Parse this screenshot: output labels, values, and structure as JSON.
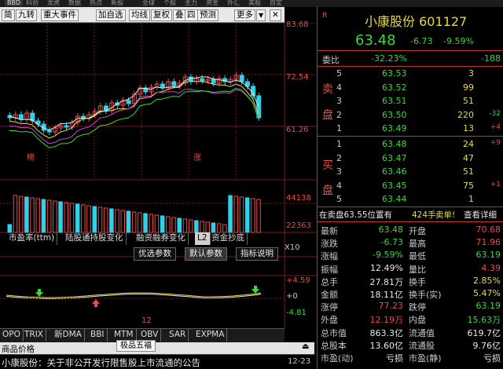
{
  "topstrip": [
    "BBD",
    "科创",
    "龙虎",
    "数据",
    "热点",
    "新股",
    "全球",
    "个股",
    "主力",
    "资金",
    "外汇",
    "美股",
    "自定"
  ],
  "toolbar": {
    "items": [
      "简",
      "九转",
      "重大事件",
      "加自选",
      "均线",
      "复权",
      "叠",
      "四",
      "预测",
      "更多"
    ],
    "arrow_down": "▼",
    "close": "✕"
  },
  "price_axis": {
    "top": "83.68",
    "mid": "72.54",
    "low": "61.26"
  },
  "volume_axis": {
    "top": "44138",
    "mid": "22363",
    "unit": "X10"
  },
  "indicator_axis": {
    "top": "+4.59",
    "zero": "+0",
    "low": "-4.81"
  },
  "markers": {
    "bang": "榜",
    "zhang": "涨",
    "date": "12"
  },
  "indicator_tabs": [
    "市盈率(ttm)",
    "陆股通持股变化",
    "融资融券变化",
    "L2",
    "资金抄底"
  ],
  "indicator_tabs_active": "L2",
  "param_tabs": [
    "优选参数",
    "默认参数",
    "指标说明"
  ],
  "bottom_tabs": [
    "OPO",
    "TRIX",
    "新DMA",
    "BBI",
    "MTM",
    "OBV",
    "SAR",
    "EXPMA"
  ],
  "bottom_popup": "极品五福",
  "news": {
    "header": "商品价格",
    "text": "小康股份：关于非公开发行限售股上市流通的公告",
    "date": "12-23"
  },
  "stock": {
    "badge": "R",
    "name": "小康股份",
    "code": "601127",
    "price": "63.48",
    "change": "-6.73",
    "change_pct": "-9.59%"
  },
  "webi": {
    "label": "委比",
    "value": "-32.23%",
    "diff": "-188"
  },
  "sell": {
    "label": "卖盘",
    "rows": [
      {
        "n": "5",
        "price": "63.53",
        "vol": "3",
        "chg": ""
      },
      {
        "n": "4",
        "price": "63.52",
        "vol": "99",
        "chg": ""
      },
      {
        "n": "3",
        "price": "63.51",
        "vol": "51",
        "chg": ""
      },
      {
        "n": "2",
        "price": "63.50",
        "vol": "220",
        "chg": "-32"
      },
      {
        "n": "1",
        "price": "63.49",
        "vol": "13",
        "chg": "+4"
      }
    ]
  },
  "buy": {
    "label": "买盘",
    "rows": [
      {
        "n": "1",
        "price": "63.48",
        "vol": "24",
        "chg": "+9"
      },
      {
        "n": "2",
        "price": "63.47",
        "vol": "47",
        "chg": ""
      },
      {
        "n": "3",
        "price": "63.46",
        "vol": "51",
        "chg": ""
      },
      {
        "n": "4",
        "price": "63.45",
        "vol": "75",
        "chg": "+1"
      },
      {
        "n": "5",
        "price": "63.44",
        "vol": "1",
        "chg": ""
      }
    ]
  },
  "sell_note": {
    "text": "在卖盘63.55位置有",
    "qty": "424手",
    "action": "卖单!",
    "link": "查看详细"
  },
  "stats": [
    {
      "l1": "最新",
      "v1": "63.48",
      "c1": "gr",
      "l2": "开盘",
      "v2": "70.68",
      "c2": "r"
    },
    {
      "l1": "涨跌",
      "v1": "-6.73",
      "c1": "gr",
      "l2": "最高",
      "v2": "71.96",
      "c2": "r"
    },
    {
      "l1": "涨幅",
      "v1": "-9.59%",
      "c1": "gr",
      "l2": "最低",
      "v2": "63.19",
      "c2": "gr"
    },
    {
      "l1": "振幅",
      "v1": "12.49%",
      "c1": "w",
      "l2": "量比",
      "v2": "4.39",
      "c2": "r"
    },
    {
      "l1": "总手",
      "v1": "27.81万",
      "c1": "w",
      "l2": "换手",
      "v2": "2.85%",
      "c2": "y"
    },
    {
      "l1": "金额",
      "v1": "18.11亿",
      "c1": "w",
      "l2": "换手(实)",
      "v2": "5.47%",
      "c2": "y"
    },
    {
      "l1": "涨停",
      "v1": "77.23",
      "c1": "r",
      "l2": "跌停",
      "v2": "63.19",
      "c2": "gr"
    },
    {
      "l1": "外盘",
      "v1": "12.19万",
      "c1": "r",
      "l2": "内盘",
      "v2": "15.63万",
      "c2": "gr"
    },
    {
      "l1": "总市值",
      "v1": "863.3亿",
      "c1": "w",
      "l2": "流通值",
      "v2": "619.7亿",
      "c2": "w"
    },
    {
      "l1": "总股本",
      "v1": "13.60亿",
      "c1": "w",
      "l2": "流通股",
      "v2": "9.76亿",
      "c2": "w"
    },
    {
      "l1": "市盈(动)",
      "v1": "亏损",
      "c1": "w",
      "l2": "市盈(静)",
      "v2": "亏损",
      "c2": "w"
    }
  ],
  "colors": {
    "up": "#e84a4a",
    "down": "#38d838",
    "accent": "#e8d84a",
    "grid": "#7a1a1a"
  }
}
